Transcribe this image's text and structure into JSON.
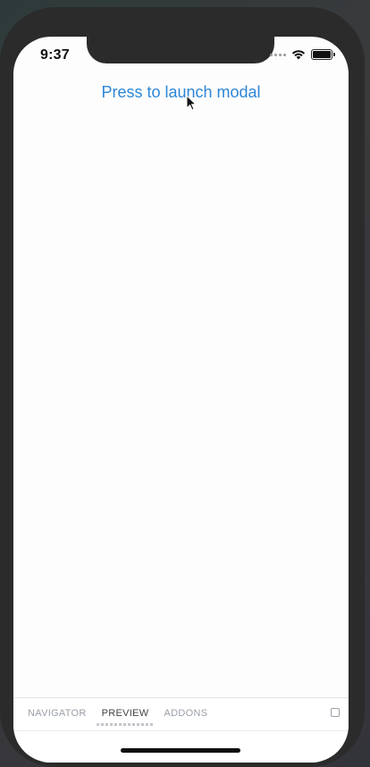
{
  "status_bar": {
    "time": "9:37",
    "icons": [
      "signal-dots-icon",
      "wifi-icon",
      "battery-icon"
    ]
  },
  "main": {
    "launch_button_label": "Press to launch modal"
  },
  "addon_panel": {
    "tabs": [
      {
        "label": "NAVIGATOR",
        "active": false
      },
      {
        "label": "PREVIEW",
        "active": true
      },
      {
        "label": "ADDONS",
        "active": false
      }
    ],
    "toggle_icon": "square-icon"
  },
  "colors": {
    "accent": "#2d86d6",
    "frame": "#2b2b2b",
    "screen_bg": "#fdfdfd"
  }
}
